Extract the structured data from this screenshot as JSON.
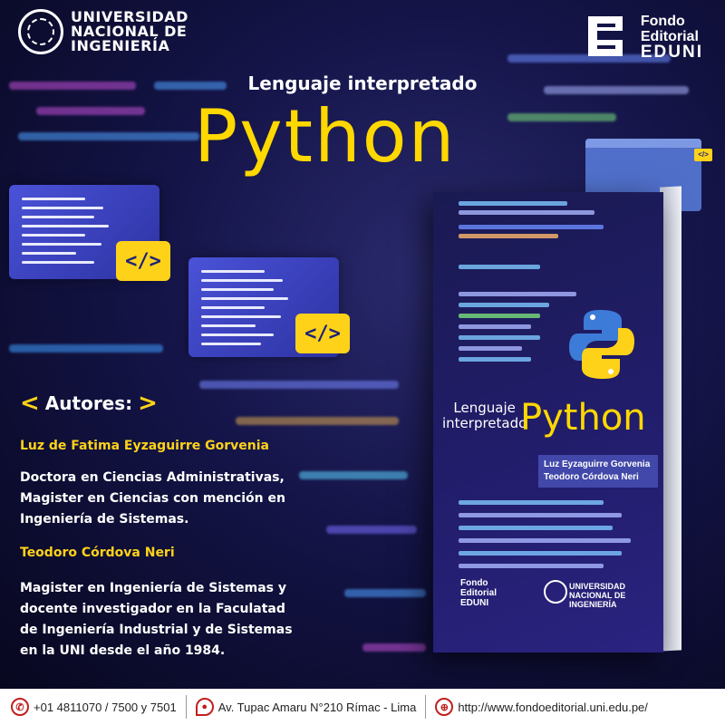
{
  "header": {
    "university": [
      "UNIVERSIDAD",
      "NACIONAL DE",
      "INGENIERÍA"
    ],
    "publisher": [
      "Fondo",
      "Editorial",
      "EDUNI"
    ]
  },
  "hero": {
    "subtitle": "Lenguaje interpretado",
    "title": "Python"
  },
  "badges": {
    "code_tag": "</>"
  },
  "book": {
    "subtitle": [
      "Lenguaje",
      "interpretado"
    ],
    "title": "Python",
    "authors": [
      "Luz Eyzaguirre Gorvenia",
      "Teodoro Córdova Neri"
    ],
    "publisher": [
      "Fondo",
      "Editorial",
      "EDUNI"
    ],
    "university": [
      "UNIVERSIDAD",
      "NACIONAL DE",
      "INGENIERÍA"
    ]
  },
  "authors": {
    "heading": "Autores:",
    "list": [
      {
        "name": "Luz de Fatima Eyzaguirre Gorvenia",
        "desc": [
          "Doctora en Ciencias Administrativas,",
          "Magister en Ciencias con mención en",
          "Ingeniería de Sistemas."
        ]
      },
      {
        "name": "Teodoro Córdova Neri",
        "desc": [
          "Magister en Ingeniería de Sistemas y",
          "docente investigador en la Faculatad",
          "de Ingeniería Industrial y de Sistemas",
          "en la UNI desde el año 1984."
        ]
      }
    ]
  },
  "footer": {
    "phone": "+01 4811070 / 7500 y 7501",
    "address": "Av. Tupac Amaru N°210 Rímac - Lima",
    "website": "http://www.fondoeditorial.uni.edu.pe/"
  },
  "colors": {
    "accent": "#ffd800",
    "background": "#141448",
    "window": "#3b40c0"
  }
}
